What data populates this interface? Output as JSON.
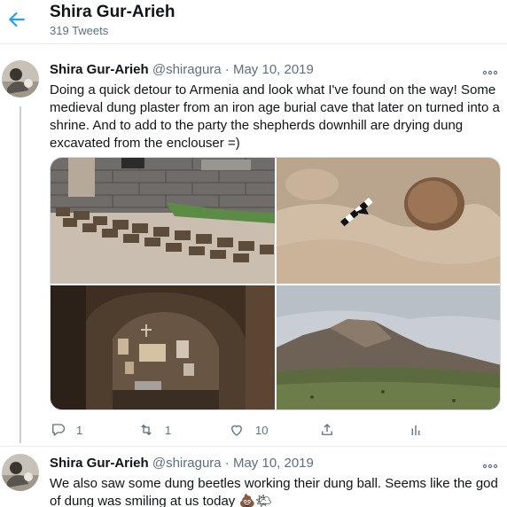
{
  "header": {
    "name": "Shira Gur-Arieh",
    "tweet_count": "319 Tweets"
  },
  "tweets": [
    {
      "name": "Shira Gur-Arieh",
      "handle": "@shiragura",
      "dot": "·",
      "date": "May 10, 2019",
      "text": "Doing a quick detour to Armenia and look what I've found on the way! Some medieval dung plaster from an iron age burial cave that later on turned into a shrine. And to add to the party the shepherds downhill are drying dung excavated from the enclouser =)",
      "actions": {
        "replies": "1",
        "retweets": "1",
        "likes": "10"
      }
    },
    {
      "name": "Shira Gur-Arieh",
      "handle": "@shiragura",
      "dot": "·",
      "date": "May 10, 2019",
      "text": "We also saw some dung beetles working their dung ball. Seems like the god of dung was smiling at us today 💩🌤"
    }
  ],
  "colors": {
    "accent": "#1da1f2",
    "secondary_text": "#5b7083",
    "border": "#e6ecf0"
  },
  "icons": [
    "back-arrow-icon",
    "more-icon",
    "reply-icon",
    "retweet-icon",
    "like-icon",
    "share-icon",
    "analytics-icon"
  ]
}
